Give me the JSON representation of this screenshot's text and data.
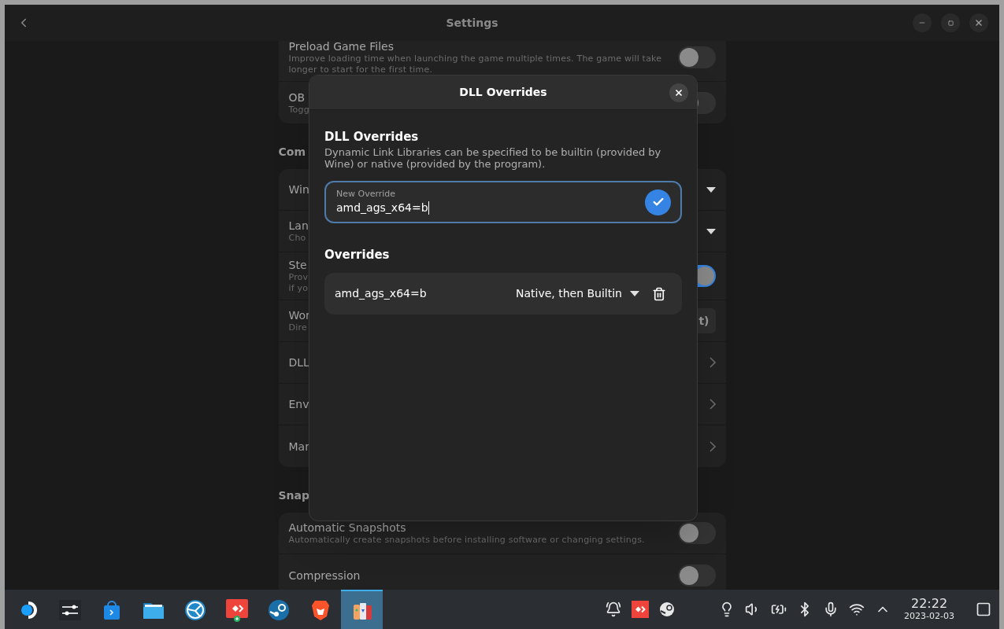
{
  "window": {
    "title": "Settings"
  },
  "settings": {
    "groups": [
      {
        "rows": [
          {
            "kind": "toggle",
            "title": "Preload Game Files",
            "subtitle": "Improve loading time when launching the game multiple times. The game will take longer to start for the first time.",
            "on": false
          },
          {
            "kind": "toggle",
            "title": "OB",
            "subtitle": "Togg",
            "on": false
          }
        ]
      },
      {
        "heading": "Com",
        "rows": [
          {
            "kind": "dropdown",
            "title": "Win"
          },
          {
            "kind": "dropdown",
            "title": "Lan",
            "subtitle": "Cho"
          },
          {
            "kind": "toggle",
            "title": "Ste",
            "subtitle": "Prov\nif yo",
            "on": true
          },
          {
            "kind": "button",
            "title": "Wor",
            "subtitle": "Dire",
            "button_label": "t)"
          },
          {
            "kind": "link",
            "title": "DLL"
          },
          {
            "kind": "link",
            "title": "Env"
          },
          {
            "kind": "link",
            "title": "Mar"
          }
        ]
      },
      {
        "heading": "Snap",
        "rows": [
          {
            "kind": "toggle",
            "title": "Automatic Snapshots",
            "subtitle": "Automatically create snapshots before installing software or changing settings.",
            "on": false
          },
          {
            "kind": "toggle",
            "title": "Compression",
            "on": false
          }
        ]
      }
    ]
  },
  "dialog": {
    "title": "DLL Overrides",
    "heading": "DLL Overrides",
    "description": "Dynamic Link Libraries can be specified to be builtin (provided by Wine) or native (provided by the program).",
    "new_override": {
      "label": "New Override",
      "value": "amd_ags_x64=b"
    },
    "list_heading": "Overrides",
    "overrides": [
      {
        "name": "amd_ags_x64=b",
        "mode": "Native, then Builtin"
      }
    ]
  },
  "taskbar": {
    "apps": [
      {
        "selected": false
      },
      {
        "selected": false
      },
      {
        "selected": false
      },
      {
        "selected": false
      },
      {
        "selected": false
      },
      {
        "selected": false
      },
      {
        "selected": false
      },
      {
        "selected": false
      },
      {
        "selected": true
      }
    ],
    "clock": {
      "time": "22:22",
      "date": "2023-02-03"
    }
  }
}
